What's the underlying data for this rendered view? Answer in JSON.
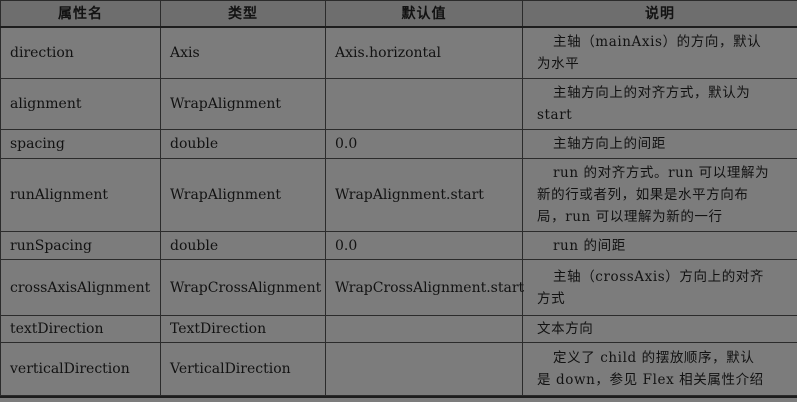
{
  "headers": [
    "属性名",
    "类型",
    "默认值",
    "说明"
  ],
  "rows": [
    {
      "name": "direction",
      "type": "Axis",
      "default": "Axis.horizontal",
      "desc_lines": [
        "主轴（mainAxis）的方向，默认",
        "为水平"
      ]
    },
    {
      "name": "alignment",
      "type": "WrapAlignment",
      "default": "",
      "desc_lines": [
        "主轴方向上的对齐方式，默认为",
        "start"
      ]
    },
    {
      "name": "spacing",
      "type": "double",
      "default": "0.0",
      "desc_lines": [
        "主轴方向上的间距"
      ]
    },
    {
      "name": "runAlignment",
      "type": "WrapAlignment",
      "default": "WrapAlignment.start",
      "desc_lines": [
        "run 的对齐方式。run 可以理解为",
        "新的行或者列，如果是水平方向布",
        "局，run 可以理解为新的一行"
      ]
    },
    {
      "name": "runSpacing",
      "type": "double",
      "default": "0.0",
      "desc_lines": [
        "run 的间距"
      ]
    },
    {
      "name": "crossAxisAlignment",
      "type": "WrapCrossAlignment",
      "default": "WrapCrossAlignment.start",
      "desc_lines": [
        "主轴（crossAxis）方向上的对齐",
        "方式"
      ]
    },
    {
      "name": "textDirection",
      "type": "TextDirection",
      "default": "",
      "desc_lines": [
        "文本方向"
      ]
    },
    {
      "name": "verticalDirection",
      "type": "VerticalDirection",
      "default": "",
      "desc_lines": [
        "定义了 child 的摆放顺序，默认",
        "是 down，参见 Flex 相关属性介绍"
      ]
    }
  ]
}
